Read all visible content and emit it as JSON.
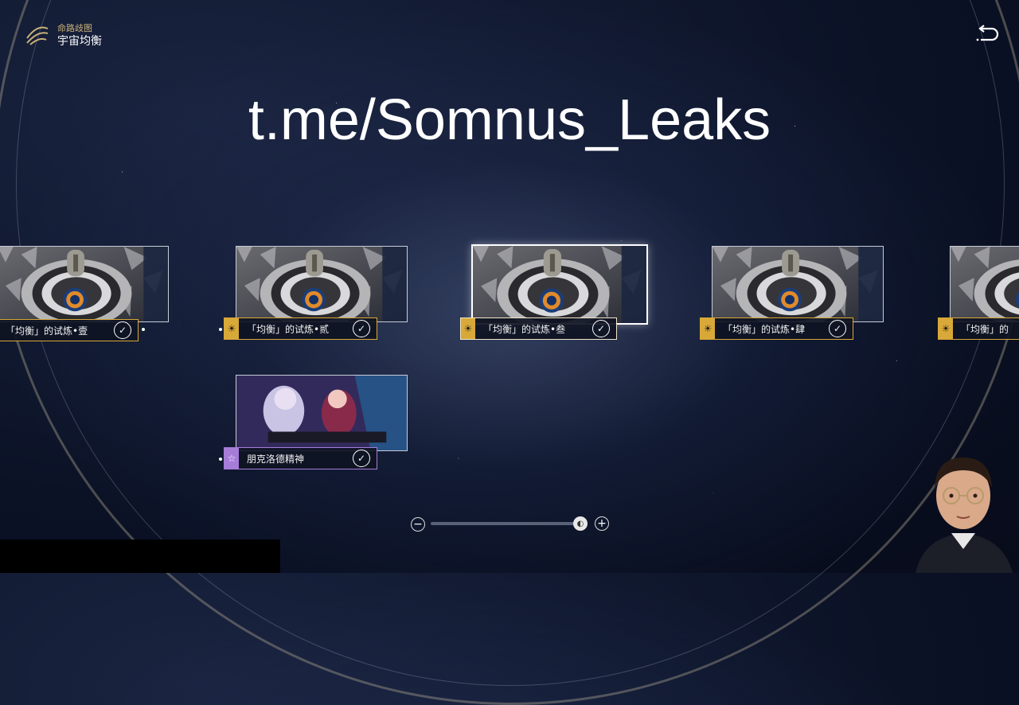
{
  "header": {
    "subtitle": "命路歧图",
    "title": "宇宙均衡",
    "logo_icon": "swirl-path-icon",
    "back_icon": "return-arrow-icon"
  },
  "watermark": "t.me/Somnus_Leaks",
  "nodes": [
    {
      "label": "「均衡」的试炼•壹",
      "tag_icon": "sun-icon",
      "completed": true
    },
    {
      "label": "「均衡」的试炼•贰",
      "tag_icon": "sun-icon",
      "completed": true
    },
    {
      "label": "「均衡」的试炼•叁",
      "tag_icon": "sun-icon",
      "completed": true,
      "selected": true
    },
    {
      "label": "「均衡」的试炼•肆",
      "tag_icon": "sun-icon",
      "completed": true
    },
    {
      "label": "「均衡」的",
      "tag_icon": "sun-icon",
      "completed": false
    },
    {
      "label": "朋克洛德精神",
      "tag_icon": "star-icon",
      "completed": true
    }
  ],
  "zoom": {
    "minus": "−",
    "plus": "+",
    "level": 0.97
  },
  "colors": {
    "gold": "#d8a838",
    "purple": "#a67cd8"
  }
}
